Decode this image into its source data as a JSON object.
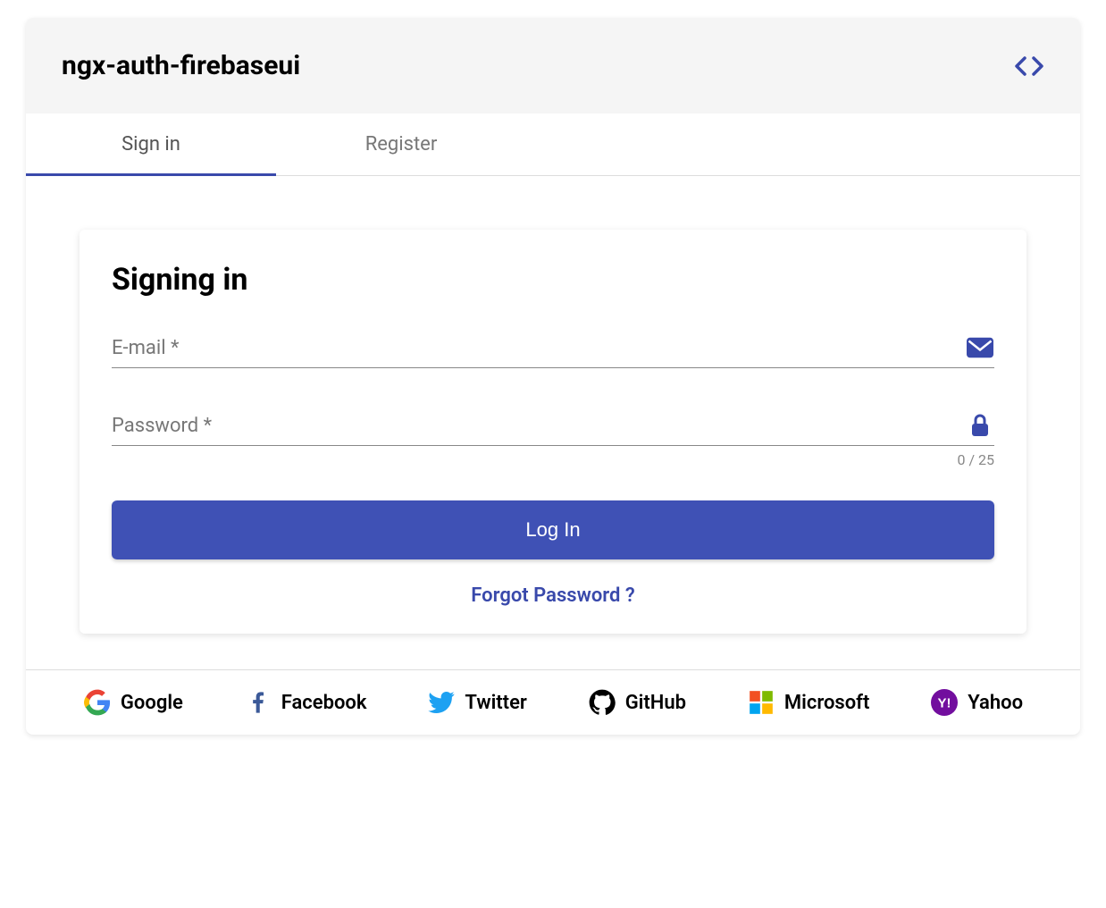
{
  "header": {
    "title": "ngx-auth-firebaseui"
  },
  "tabs": [
    {
      "label": "Sign in",
      "active": true
    },
    {
      "label": "Register",
      "active": false
    }
  ],
  "card": {
    "title": "Signing in",
    "email_label": "E-mail *",
    "password_label": "Password *",
    "password_counter": "0 / 25",
    "login_button": "Log In",
    "forgot_link": "Forgot Password ?"
  },
  "providers": [
    {
      "name": "Google"
    },
    {
      "name": "Facebook"
    },
    {
      "name": "Twitter"
    },
    {
      "name": "GitHub"
    },
    {
      "name": "Microsoft"
    },
    {
      "name": "Yahoo"
    }
  ]
}
